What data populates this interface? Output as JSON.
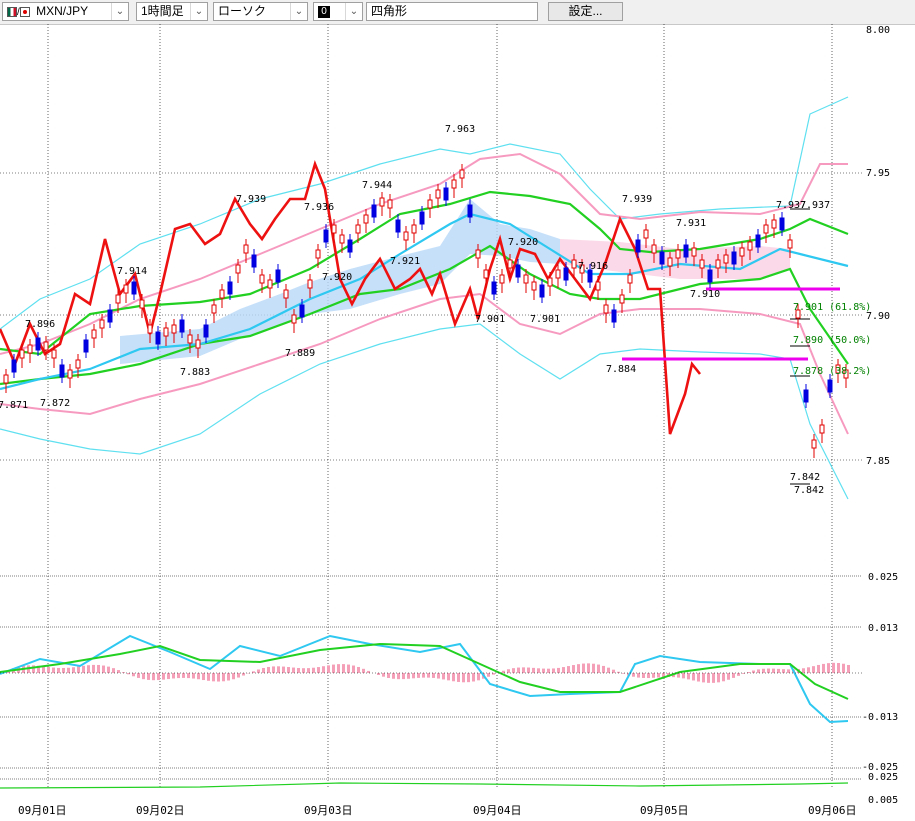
{
  "toolbar": {
    "pair": "MXN/JPY",
    "timeframe": "1時間足",
    "chart_style": "ローソク",
    "color_swatch_label": "0",
    "drawing_tool": "四角形",
    "settings_button": "設定..."
  },
  "price_axis": {
    "top_label": "8.00",
    "labels": [
      "7.95",
      "7.90",
      "7.85"
    ]
  },
  "indicator1_axis": {
    "labels": [
      "0.025",
      "0.013",
      "-0.013",
      "-0.025"
    ]
  },
  "indicator2_axis": {
    "labels": [
      "0.025",
      "0.005"
    ]
  },
  "time_axis": {
    "labels": [
      "09月01日",
      "09月02日",
      "09月03日",
      "09月04日",
      "09月05日",
      "09月06日"
    ]
  },
  "annotations": {
    "price_marks": [
      "7.896",
      "7.871",
      "7.872",
      "7.914",
      "7.883",
      "7.939",
      "7.936",
      "7.889",
      "7.944",
      "7.920",
      "7.921",
      "7.963",
      "7.901",
      "7.920",
      "7.901",
      "7.916",
      "7.939",
      "7.884",
      "7.931",
      "7.910",
      "7.937",
      "7.937",
      "7.842",
      "7.842"
    ],
    "fib_labels": [
      "7.901 (61.8%)",
      "7.890 (50.0%)",
      "7.878 (38.2%)"
    ]
  },
  "colors": {
    "up_candle": "#e00000",
    "down_candle": "#0000e0",
    "bollinger_outer": "#5fe0f0",
    "bollinger_inner": "#f79ac0",
    "ma_green": "#22d022",
    "ma_blue": "#2ec8f0",
    "ma_red": "#ee1111",
    "ichimoku_cloud_blue": "#b8d8f8",
    "ichimoku_cloud_pink": "#f8c0d8",
    "fib_line": "#ee00ee",
    "macd_hist": "#f4a0b8"
  },
  "chart_data": {
    "type": "line",
    "title": "",
    "xlabel": "",
    "ylabel": "",
    "ylim": [
      7.83,
      8.0
    ],
    "x": [
      "09月01日",
      "09月02日",
      "09月03日",
      "09月04日",
      "09月05日",
      "09月06日"
    ],
    "series": [
      {
        "values": [
          7.905,
          7.93,
          7.925,
          7.94,
          7.9,
          7.88
        ]
      }
    ]
  }
}
